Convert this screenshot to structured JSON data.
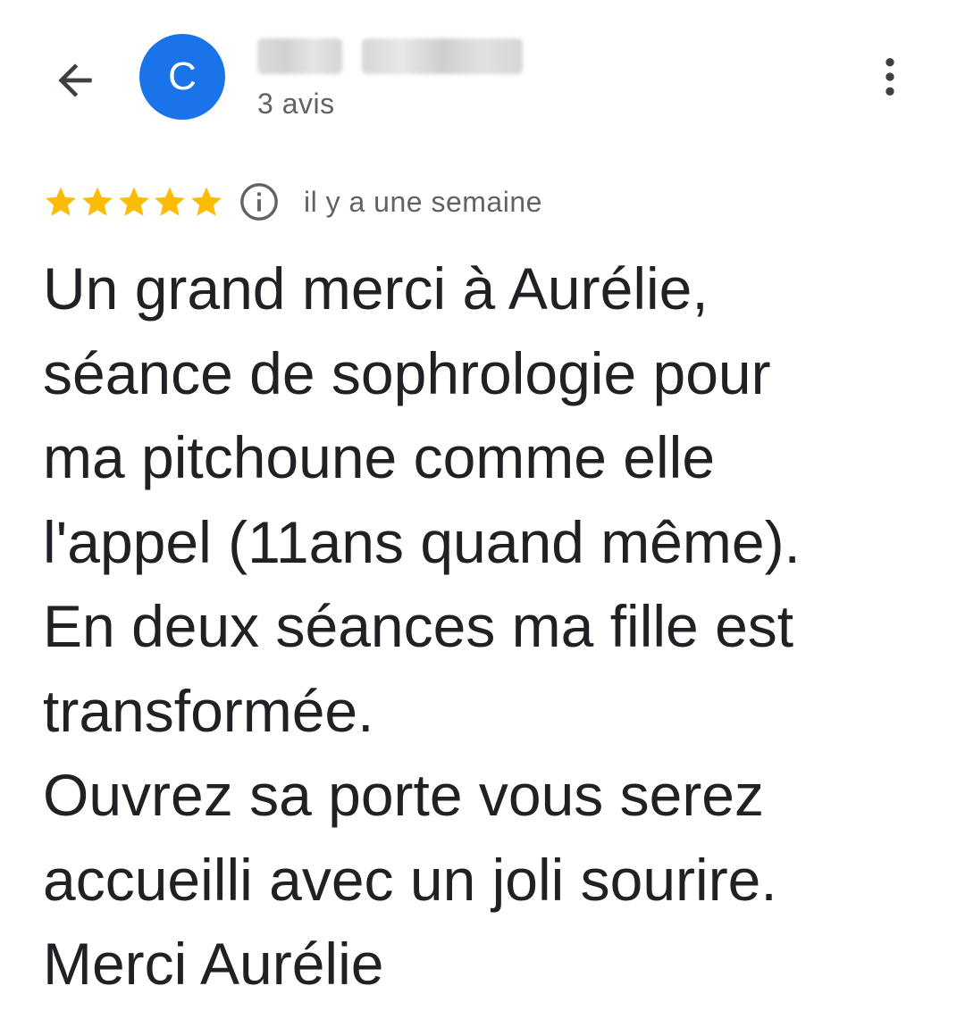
{
  "header": {
    "avatar_letter": "C",
    "avatar_color": "#1a73e8",
    "review_count": "3 avis",
    "back_icon": "arrow-back-icon",
    "more_icon": "more-vert-icon"
  },
  "review": {
    "rating": 5,
    "max_rating": 5,
    "star_color": "#fbbc04",
    "time": "il y a une semaine",
    "info_icon": "info-icon",
    "lines": [
      "Un grand merci à Aurélie,",
      "séance de sophrologie pour",
      "ma pitchoune comme elle",
      "l'appel (11ans quand même).",
      "En deux séances ma fille est",
      "transformée.",
      "Ouvrez sa porte vous serez",
      "accueilli avec un joli sourire.",
      "Merci Aurélie"
    ]
  }
}
